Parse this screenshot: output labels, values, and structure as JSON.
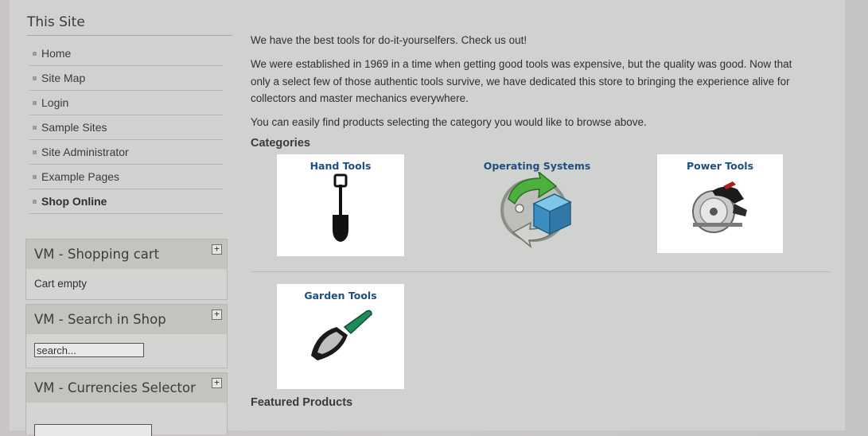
{
  "sidebar": {
    "title": "This Site",
    "menu": [
      {
        "label": "Home"
      },
      {
        "label": "Site Map"
      },
      {
        "label": "Login"
      },
      {
        "label": "Sample Sites"
      },
      {
        "label": "Site Administrator"
      },
      {
        "label": "Example Pages"
      },
      {
        "label": "Shop Online",
        "active": true
      }
    ],
    "modules": {
      "cart": {
        "title": "VM - Shopping cart",
        "toggle": "+",
        "body": "Cart empty"
      },
      "search": {
        "title": "VM - Search in Shop",
        "toggle": "+",
        "input_value": "search..."
      },
      "currencies": {
        "title": "VM - Currencies Selector",
        "toggle": "+"
      }
    }
  },
  "main": {
    "intro": "We have the best tools for do-it-yourselfers. Check us out!",
    "history": "We were established in 1969 in a time when getting good tools was expensive, but the quality was good. Now that only a select few of those authentic tools survive, we have dedicated this store to bringing the experience alive for collectors and master mechanics everywhere.",
    "browse_hint": "You can easily find products selecting the category you would like to browse above.",
    "categories_heading": "Categories",
    "categories": [
      {
        "name": "Hand Tools",
        "icon": "shovel-icon"
      },
      {
        "name": "Operating Systems",
        "icon": "software-package-icon"
      },
      {
        "name": "Power Tools",
        "icon": "circular-saw-icon"
      },
      {
        "name": "Garden Tools",
        "icon": "trowel-icon"
      }
    ],
    "featured_heading": "Featured Products"
  },
  "colors": {
    "page_bg": "#d0d2cf",
    "category_link": "#1f4f82",
    "module_header": "#c2c4c0"
  }
}
